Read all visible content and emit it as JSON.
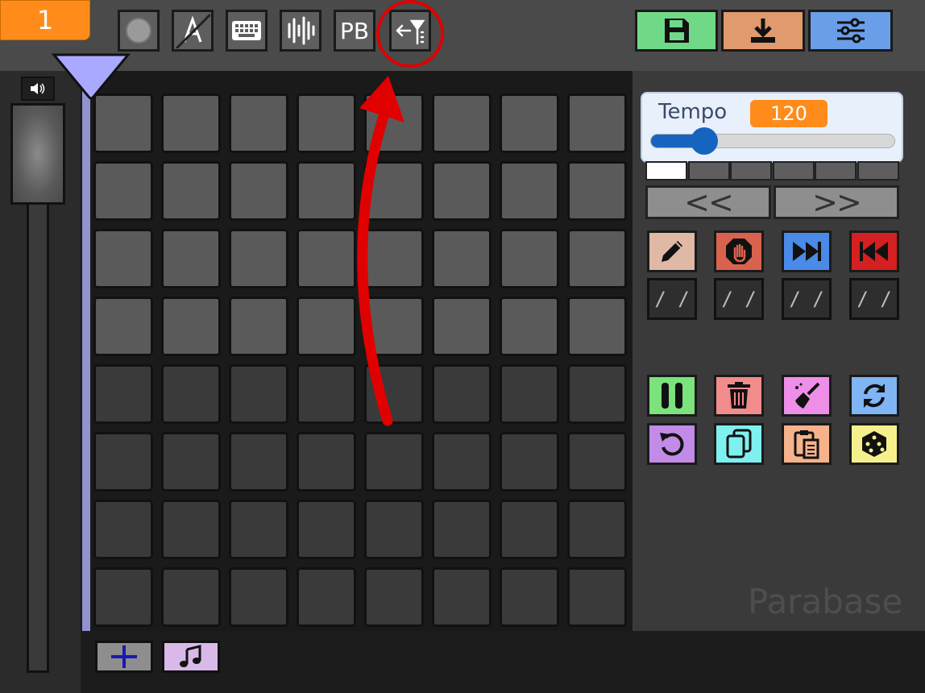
{
  "header": {
    "track_number": "1",
    "toolbar": [
      {
        "name": "record-button",
        "icon": "record-circle-icon"
      },
      {
        "name": "autokey-button",
        "icon": "a-slashed-icon"
      },
      {
        "name": "keyboard-button",
        "icon": "keyboard-icon"
      },
      {
        "name": "waveform-button",
        "icon": "waveform-icon"
      },
      {
        "name": "playback-button",
        "label": "PB"
      },
      {
        "name": "filter-back-button",
        "icon": "arrow-left-filter-icon"
      }
    ],
    "right_buttons": [
      {
        "name": "save-button",
        "icon": "floppy-disk-icon",
        "color": "#6fd988"
      },
      {
        "name": "download-button",
        "icon": "download-icon",
        "color": "#e09a6e"
      },
      {
        "name": "settings-button",
        "icon": "sliders-icon",
        "color": "#6a9ee8"
      }
    ]
  },
  "tempo": {
    "label": "Tempo",
    "value": "120",
    "slider_fraction": 0.18
  },
  "pattern_steps": {
    "count": 6,
    "active_index": 0
  },
  "navigation": {
    "prev": "<<",
    "next": ">>"
  },
  "actions": [
    {
      "name": "pencil-button",
      "icon": "pencil-icon",
      "color": "#dfb9a6"
    },
    {
      "name": "stop-button",
      "icon": "hand-stop-icon",
      "color": "#d9624e"
    },
    {
      "name": "fast-forward-button",
      "icon": "fast-forward-icon",
      "color": "#4a8ae8"
    },
    {
      "name": "rewind-button",
      "icon": "rewind-icon",
      "color": "#d42020"
    }
  ],
  "slash_label": "/ /",
  "tools": [
    {
      "name": "pause-button",
      "icon": "pause-icon",
      "color": "#7ce27c"
    },
    {
      "name": "delete-button",
      "icon": "trash-icon",
      "color": "#f28b8b"
    },
    {
      "name": "clear-button",
      "icon": "broom-icon",
      "color": "#ef8ee8"
    },
    {
      "name": "refresh-button",
      "icon": "sync-icon",
      "color": "#7fb5f5"
    },
    {
      "name": "undo-button",
      "icon": "undo-icon",
      "color": "#c28be8"
    },
    {
      "name": "copy-button",
      "icon": "copy-icon",
      "color": "#7ff0f0"
    },
    {
      "name": "paste-button",
      "icon": "paste-icon",
      "color": "#f5b28b"
    },
    {
      "name": "random-button",
      "icon": "dice-icon",
      "color": "#f5f08b"
    }
  ],
  "watermark": "Parabase",
  "bottom": [
    {
      "name": "add-button",
      "icon": "plus-icon",
      "color": "#8e8e8e"
    },
    {
      "name": "music-button",
      "icon": "music-note-icon",
      "color": "#d9b9e8"
    }
  ],
  "colors": {
    "pad_light": "#5a5a5a",
    "pad_dark": "#3a3a3a",
    "highlight": "#e00000"
  }
}
